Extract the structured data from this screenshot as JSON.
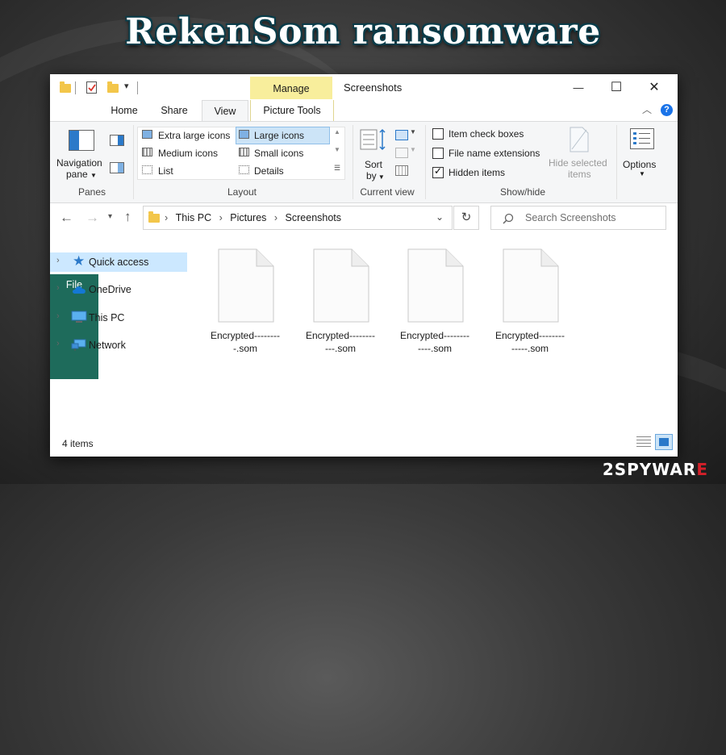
{
  "headline": "RekenSom ransomware",
  "watermark": {
    "prefix": "2SPYWAR",
    "suffix": "E"
  },
  "window": {
    "title": "Screenshots",
    "context_tab": "Manage",
    "controls": {
      "minimize": "—",
      "maximize": "☐",
      "close": "✕"
    }
  },
  "tabs": {
    "file": "File",
    "home": "Home",
    "share": "Share",
    "view": "View",
    "picture_tools": "Picture Tools"
  },
  "ribbon": {
    "panes": {
      "nav_line1": "Navigation",
      "nav_line2": "pane",
      "label": "Panes"
    },
    "layout": {
      "items": [
        "Extra large icons",
        "Large icons",
        "Medium icons",
        "Small icons",
        "List",
        "Details"
      ],
      "selected": "Large icons",
      "label": "Layout"
    },
    "current_view": {
      "sort_line1": "Sort",
      "sort_line2": "by",
      "label": "Current view"
    },
    "show_hide": {
      "item_check_boxes": "Item check boxes",
      "file_name_extensions": "File name extensions",
      "hidden_items": "Hidden items",
      "hide_selected_line1": "Hide selected",
      "hide_selected_line2": "items",
      "label": "Show/hide",
      "checked": {
        "item_check_boxes": false,
        "file_name_extensions": false,
        "hidden_items": true
      }
    },
    "options": {
      "label": "Options"
    }
  },
  "address": {
    "path": [
      "This PC",
      "Pictures",
      "Screenshots"
    ],
    "sep": "›"
  },
  "search": {
    "placeholder": "Search Screenshots"
  },
  "nav_pane": {
    "items": [
      "Quick access",
      "OneDrive",
      "This PC",
      "Network"
    ],
    "selected": "Quick access"
  },
  "files": [
    {
      "line1": "Encrypted--------",
      "line2": "-.som"
    },
    {
      "line1": "Encrypted--------",
      "line2": "---.som"
    },
    {
      "line1": "Encrypted--------",
      "line2": "----.som"
    },
    {
      "line1": "Encrypted--------",
      "line2": "-----.som"
    }
  ],
  "status": {
    "item_count": "4 items"
  },
  "colors": {
    "file_tab": "#1e6b5b",
    "manage": "#f8ee9c",
    "selection": "#cce8ff",
    "help": "#1a73e8"
  }
}
